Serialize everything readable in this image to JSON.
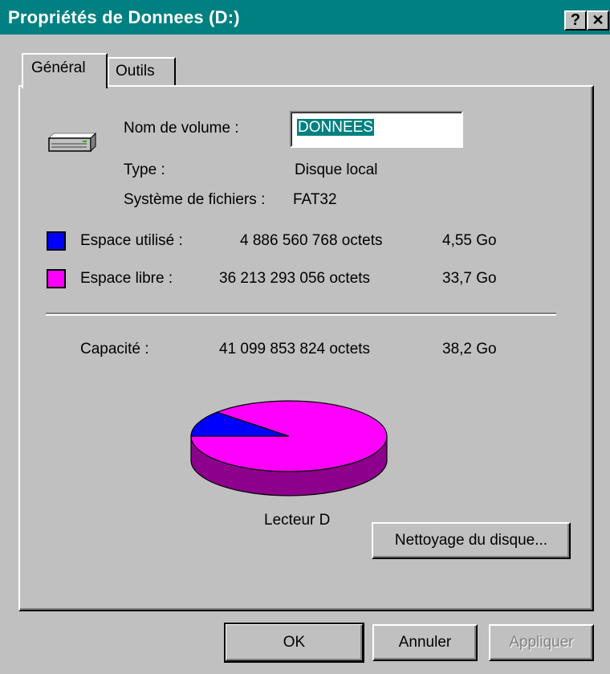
{
  "window": {
    "title": "Propriétés de Donnees (D:)",
    "help_glyph": "?",
    "close_glyph": "✕"
  },
  "tabs": [
    {
      "label": "Général",
      "active": true
    },
    {
      "label": "Outils",
      "active": false
    }
  ],
  "general": {
    "volume_name_label": "Nom de volume :",
    "volume_name_value": "DONNEES",
    "type_label": "Type :",
    "type_value": "Disque local",
    "fs_label": "Système de fichiers :",
    "fs_value": "FAT32",
    "used": {
      "label": "Espace utilisé :",
      "bytes": "4 886 560 768 octets",
      "size": "4,55 Go",
      "color": "#0000ff"
    },
    "free": {
      "label": "Espace libre :",
      "bytes": "36 213 293 056 octets",
      "size": "33,7 Go",
      "color": "#ff00ff"
    },
    "capacity": {
      "label": "Capacité :",
      "bytes": "41 099 853 824 octets",
      "size": "38,2 Go"
    },
    "drive_label": "Lecteur D",
    "cleanup_button": "Nettoyage du disque..."
  },
  "chart_data": {
    "type": "pie",
    "series": [
      {
        "name": "Espace utilisé",
        "value": 4886560768,
        "color": "#0000ff"
      },
      {
        "name": "Espace libre",
        "value": 36213293056,
        "color": "#ff00ff"
      }
    ]
  },
  "buttons": {
    "ok": "OK",
    "cancel": "Annuler",
    "apply": "Appliquer"
  }
}
